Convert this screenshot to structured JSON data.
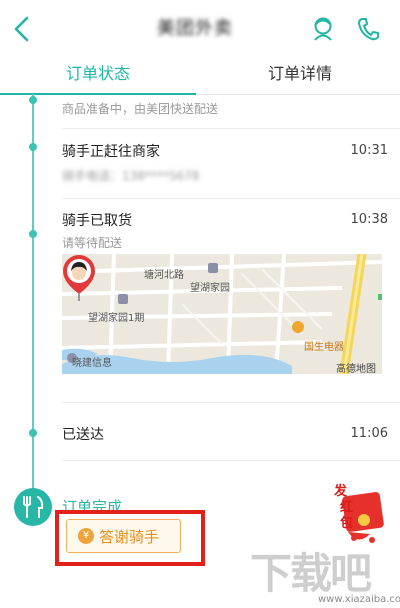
{
  "header": {
    "title": "美团外卖",
    "back_icon": "chevron-left-icon",
    "rider_icon": "rider-contact-icon",
    "phone_icon": "phone-icon",
    "accent": "#1fb6a6"
  },
  "tabs": [
    {
      "label": "订单状态",
      "active": true
    },
    {
      "label": "订单详情",
      "active": false
    }
  ],
  "timeline": [
    {
      "sub": "商品准备中，由美团快送配送"
    },
    {
      "title": "骑手正赶往商家",
      "time": "10:31",
      "sub": "骑手电话：138****5678"
    },
    {
      "title": "骑手已取货",
      "time": "10:38",
      "sub": "请等待配送"
    },
    {
      "title": "已送达",
      "time": "11:06"
    }
  ],
  "map": {
    "labels": {
      "road": "塘河北路",
      "place1": "望湖家园",
      "place2": "望湖家园1期",
      "store": "国生电器",
      "poi": "晓建信息",
      "provider": "高德地图"
    }
  },
  "complete": {
    "label": "订单完成",
    "button_label": "答谢骑手",
    "coin_symbol": "¥"
  },
  "promo": {
    "text1": "发",
    "text2": "红",
    "text3": "包"
  },
  "watermark": {
    "logo": "下载吧",
    "url": "www.xiazaiba.com"
  }
}
